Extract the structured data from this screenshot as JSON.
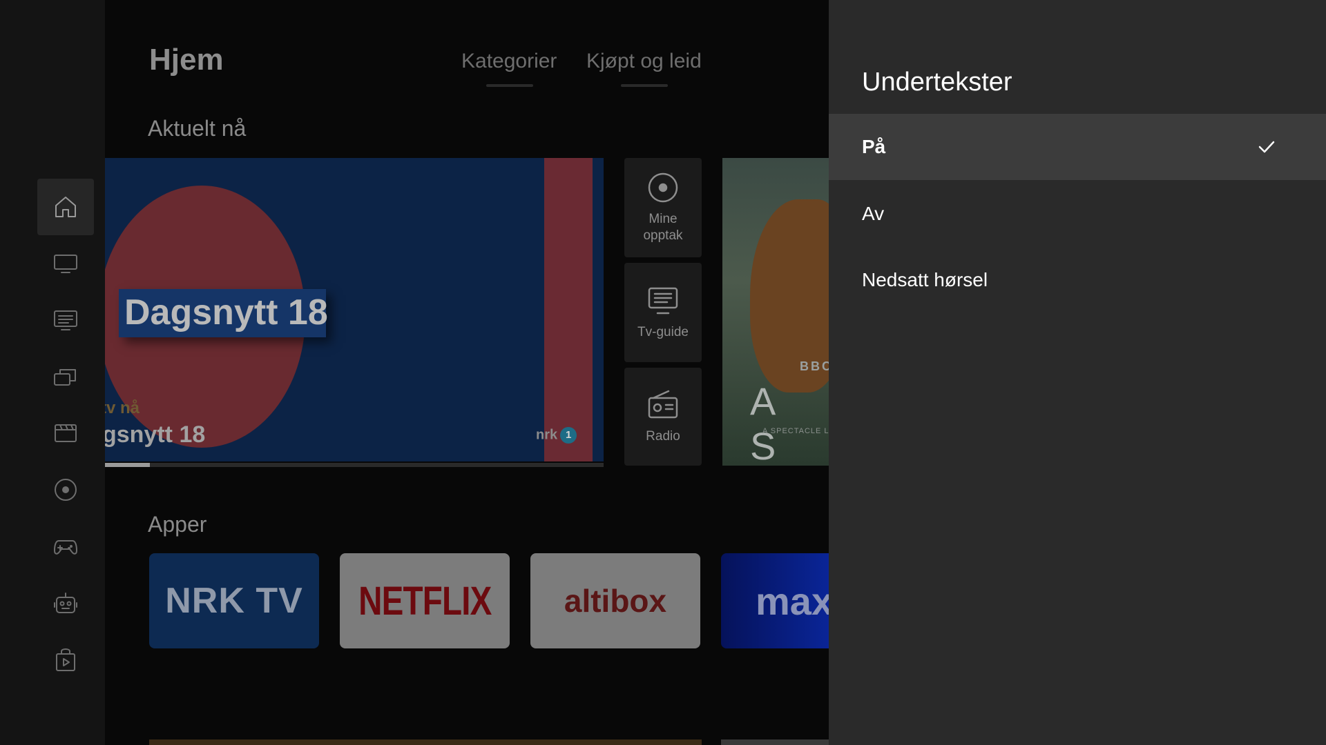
{
  "page": {
    "title": "Hjem",
    "tabs": [
      {
        "label": "Kategorier"
      },
      {
        "label": "Kjøpt og leid"
      }
    ]
  },
  "sidebar": {
    "items": [
      {
        "icon": "home-icon",
        "active": true
      },
      {
        "icon": "tv-icon",
        "active": false
      },
      {
        "icon": "guide-icon",
        "active": false
      },
      {
        "icon": "library-icon",
        "active": false
      },
      {
        "icon": "film-icon",
        "active": false
      },
      {
        "icon": "record-icon",
        "active": false
      },
      {
        "icon": "gamepad-icon",
        "active": false
      },
      {
        "icon": "kids-robot-icon",
        "active": false
      },
      {
        "icon": "store-icon",
        "active": false
      }
    ]
  },
  "current": {
    "section_title": "Aktuelt nå",
    "hero": {
      "banner_text": "Dagsnytt 18",
      "live_label": "tv nå",
      "show_title": "gsnytt 18",
      "channel_logo": "nrk",
      "channel_number": "1",
      "progress": 0.09
    },
    "tiles": [
      {
        "label": "Mine opptak",
        "icon": "record-icon"
      },
      {
        "label": "Tv-guide",
        "icon": "guide-icon"
      },
      {
        "label": "Radio",
        "icon": "radio-icon"
      }
    ],
    "poster": {
      "brand": "BBC",
      "title": "A S",
      "subtitle": "A SPECTACLE L"
    }
  },
  "apps": {
    "section_title": "Apper",
    "items": [
      {
        "name": "NRK TV",
        "logo_text": "NRK TV"
      },
      {
        "name": "Netflix",
        "logo_text": "NETFLIX"
      },
      {
        "name": "Altibox",
        "logo_text": "altibox"
      },
      {
        "name": "Max",
        "logo_text": "max"
      }
    ]
  },
  "subtitles_panel": {
    "title": "Undertekster",
    "options": [
      {
        "label": "På",
        "selected": true
      },
      {
        "label": "Av",
        "selected": false
      },
      {
        "label": "Nedsatt hørsel",
        "selected": false
      }
    ]
  },
  "colors": {
    "panel_bg": "#2a2a2a",
    "selected_bg": "#3c3c3c",
    "background": "#080808"
  }
}
